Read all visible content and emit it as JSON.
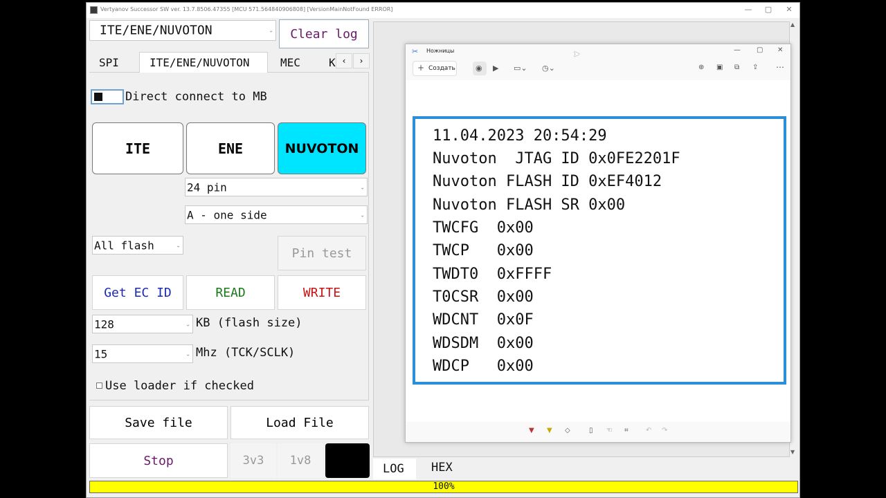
{
  "window": {
    "title": "Vertyanov Successor SW ver. 13.7.8506.47355 [MCU 571.564840906808] [VersionMainNotFound ERROR]",
    "min": "—",
    "max": "▢",
    "close": "✕"
  },
  "top": {
    "chip_select": "ITE/ENE/NUVOTON",
    "clear_log": "Clear log"
  },
  "tabs": [
    "SPI",
    "ITE/ENE/NUVOTON",
    "MEC",
    "K"
  ],
  "tab_scroll": {
    "left": "‹",
    "right": "›"
  },
  "direct_connect": "Direct connect to MB",
  "vendors": [
    "ITE",
    "ENE",
    "NUVOTON"
  ],
  "pins_select": "24 pin",
  "side_select": "A - one side",
  "flash_select": "All flash",
  "pin_test": "Pin test",
  "actions": {
    "get_id": "Get EC ID",
    "read": "READ",
    "write": "WRITE"
  },
  "flash_size": {
    "value": "128",
    "label": "KB (flash size)"
  },
  "freq": {
    "value": "15",
    "label": "Mhz (TCK/SCLK)"
  },
  "loader": "Use loader if checked",
  "file": {
    "save": "Save file",
    "load": "Load File"
  },
  "bottom": {
    "stop": "Stop",
    "v33": "3v3",
    "v18": "1v8"
  },
  "log_tabs": [
    "LOG",
    "HEX"
  ],
  "progress": {
    "text": "100%",
    "value": 1.0
  },
  "snip": {
    "title": "Ножницы",
    "create": "Создать",
    "min": "—",
    "max": "▢",
    "close": "✕",
    "lines": [
      "11.04.2023 20:54:29",
      "Nuvoton  JTAG ID 0x0FE2201F",
      "Nuvoton FLASH ID 0xEF4012",
      "Nuvoton FLASH SR 0x00",
      "TWCFG  0x00",
      "TWCP   0x00",
      "TWDT0  0xFFFF",
      "T0CSR  0x00",
      "WDCNT  0x0F",
      "WDSDM  0x00",
      "WDCP   0x00"
    ]
  },
  "colors": {
    "accent": "#00e5ff",
    "progress": "#ffff00",
    "capture_border": "#2a8fd8",
    "read": "#1a7a1a",
    "write": "#cc1111",
    "get_id": "#1a2ab0"
  }
}
